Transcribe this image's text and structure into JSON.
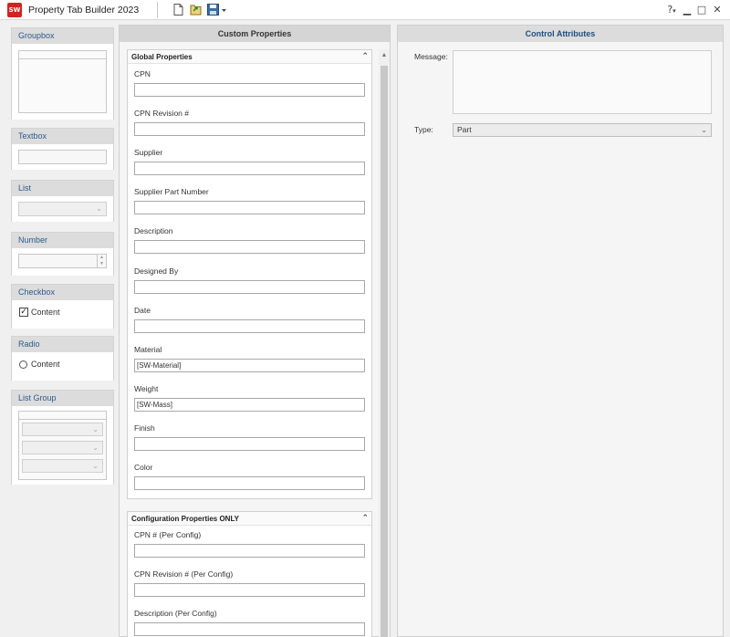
{
  "window": {
    "title": "Property Tab Builder   2023",
    "logo_text": "SW",
    "toolbar_icons": [
      "new-document-icon",
      "open-file-icon",
      "save-icon",
      "dropdown-caret-icon"
    ],
    "help_label": "?",
    "controls": [
      "help-icon",
      "minimize-icon",
      "maximize-icon",
      "close-icon"
    ]
  },
  "palette": {
    "groupbox": "Groupbox",
    "textbox": "Textbox",
    "list": "List",
    "number": "Number",
    "checkbox": {
      "label": "Checkbox",
      "content": "Content",
      "checked": true
    },
    "radio": {
      "label": "Radio",
      "content": "Content",
      "selected": false
    },
    "list_group": "List Group"
  },
  "custom_properties": {
    "title": "Custom Properties",
    "global": {
      "title": "Global Properties",
      "fields": [
        {
          "label": "CPN",
          "value": ""
        },
        {
          "label": "CPN Revision #",
          "value": ""
        },
        {
          "label": "Supplier",
          "value": ""
        },
        {
          "label": "Supplier Part Number",
          "value": ""
        },
        {
          "label": "Description",
          "value": ""
        },
        {
          "label": "Designed By",
          "value": ""
        },
        {
          "label": "Date",
          "value": ""
        },
        {
          "label": "Material",
          "value": "[SW-Material]"
        },
        {
          "label": "Weight",
          "value": "[SW-Mass]"
        },
        {
          "label": "Finish",
          "value": ""
        },
        {
          "label": "Color",
          "value": ""
        }
      ]
    },
    "config": {
      "title": "Configuration Properties ONLY",
      "fields": [
        {
          "label": "CPN # (Per Config)",
          "value": ""
        },
        {
          "label": "CPN Revision # (Per Config)",
          "value": ""
        },
        {
          "label": "Description (Per Config)",
          "value": ""
        }
      ]
    }
  },
  "control_attributes": {
    "title": "Control Attributes",
    "message_label": "Message:",
    "message_value": "",
    "type_label": "Type:",
    "type_value": "Part"
  },
  "colors": {
    "accent_text": "#2c5a8c",
    "logo_red": "#d32222",
    "header_gray": "#d5d5d5"
  }
}
